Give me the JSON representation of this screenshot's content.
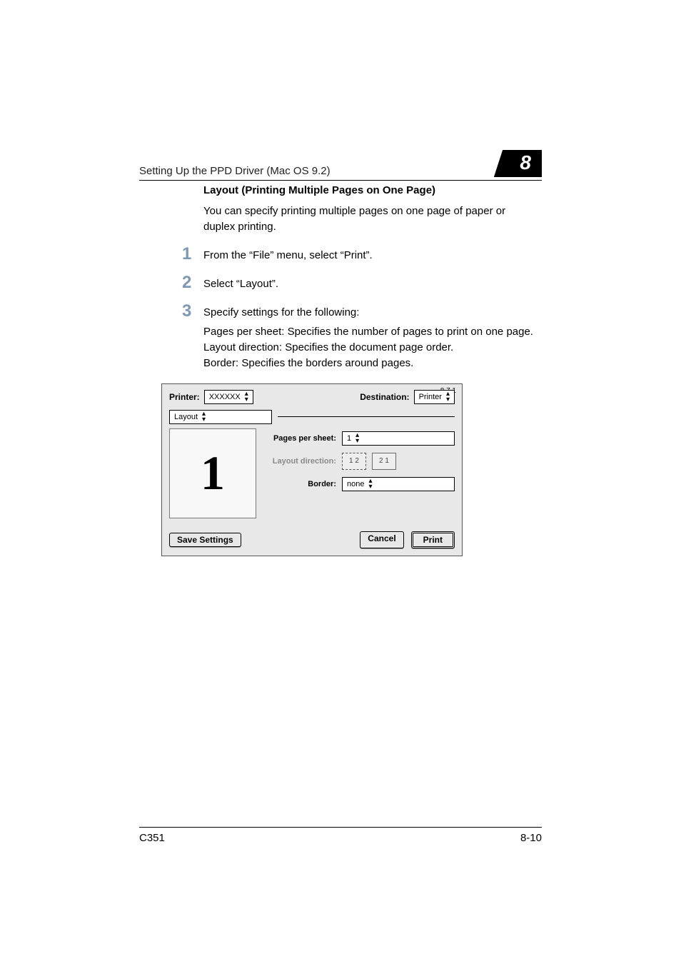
{
  "header": {
    "running_title": "Setting Up the PPD Driver (Mac OS 9.2)",
    "chapter_number": "8"
  },
  "section": {
    "heading": "Layout (Printing Multiple Pages on One Page)",
    "intro": "You can specify printing multiple pages on one page of paper or duplex printing."
  },
  "steps": [
    {
      "num": "1",
      "text": "From the “File” menu, select “Print”."
    },
    {
      "num": "2",
      "text": "Select “Layout”."
    },
    {
      "num": "3",
      "text": "Specify settings for the following:",
      "notes": "Pages per sheet: Specifies the number of pages to print on one page.\nLayout direction: Specifies the document page order.\nBorder: Specifies the borders around pages."
    }
  ],
  "dialog": {
    "version": "8.7.1",
    "printer_label": "Printer:",
    "printer_value": "XXXXXX",
    "destination_label": "Destination:",
    "destination_value": "Printer",
    "panel_popup": "Layout",
    "pages_per_sheet_label": "Pages per sheet:",
    "pages_per_sheet_value": "1",
    "layout_direction_label": "Layout direction:",
    "layout_direction_opt1": "1 2",
    "layout_direction_opt2": "2 1",
    "border_label": "Border:",
    "border_value": "none",
    "preview_digit": "1",
    "save_settings_label": "Save Settings",
    "cancel_label": "Cancel",
    "print_label": "Print"
  },
  "footer": {
    "model": "C351",
    "page_num": "8-10"
  }
}
